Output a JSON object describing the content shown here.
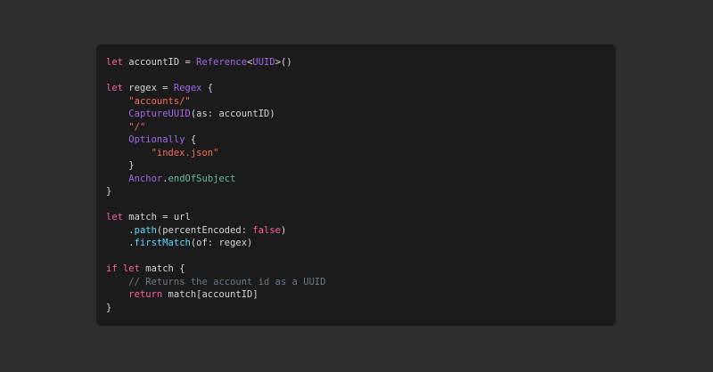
{
  "code": {
    "tokens": {
      "let": "let",
      "account_id_decl": " accountID = ",
      "reference": "Reference",
      "lt": "<",
      "uuid": "UUID",
      "gt_parens": ">()",
      "regex_decl": " regex = ",
      "regex_type": "Regex",
      "open_brace_space": " {",
      "accounts_str": "\"accounts/\"",
      "capture_uuid": "CaptureUUID",
      "capture_args": "(as: accountID)",
      "slash_str": "\"/\"",
      "optionally": "Optionally",
      "index_json_str": "\"index.json\"",
      "close_brace": "}",
      "anchor": "Anchor",
      "dot": ".",
      "end_of_subject": "endOfSubject",
      "match_decl": " match = url",
      "path": "path",
      "path_args_open": "(percentEncoded: ",
      "false": "false",
      "close_paren": ")",
      "first_match": "firstMatch",
      "first_match_args": "(of: regex)",
      "if": "if",
      "match_word": " match",
      "comment": "// Returns the account id as a UUID",
      "return": "return",
      "return_expr": " match[accountID]"
    },
    "indent1": "    ",
    "indent2": "        ",
    "space": " "
  },
  "colors": {
    "keyword": "#fc5fa3",
    "type": "#a167e6",
    "string": "#fc6a5d",
    "property": "#67b7a4",
    "method": "#5dd8ff",
    "comment": "#6c7986",
    "plain": "#d4d4d4",
    "card_bg": "#1b1b1b",
    "page_bg": "#2d2d2d"
  }
}
